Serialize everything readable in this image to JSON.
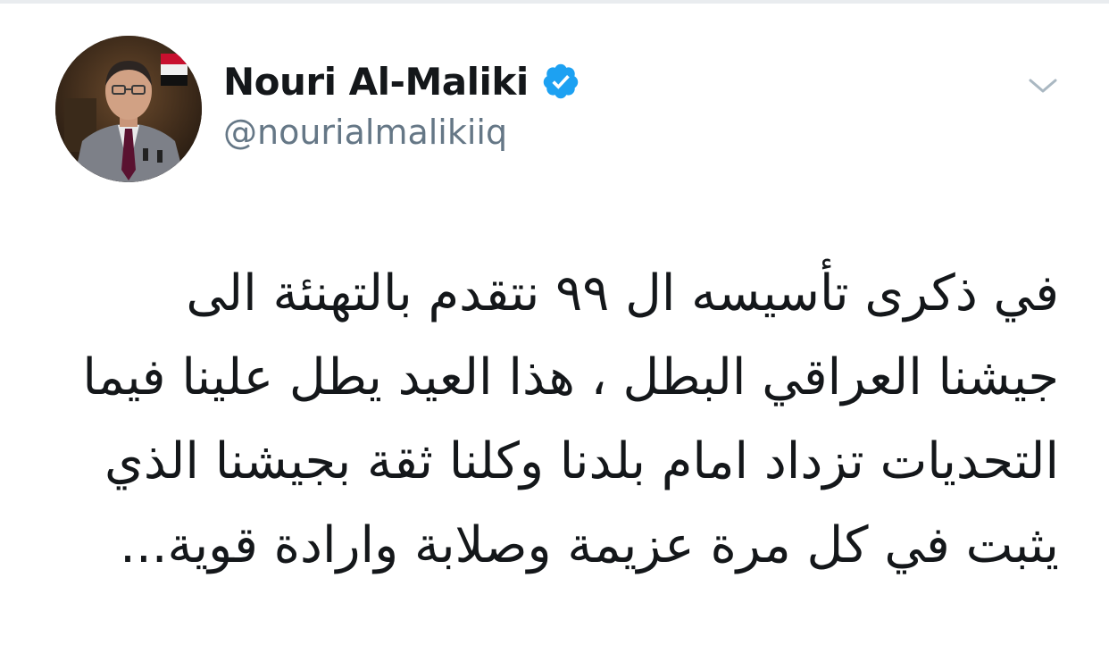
{
  "tweet": {
    "author": {
      "display_name": "Nouri Al-Maliki",
      "handle": "@nourialmalikiiq",
      "verified": true,
      "avatar_icon": "profile-photo"
    },
    "menu_icon": "chevron-down-icon",
    "text_lines": [
      "في ذكرى تأسيسه ال ٩٩ نتقدم بالتهنئة الى",
      "جيشنا العراقي البطل ، هذا العيد يطل علينا فيما",
      "التحديات تزداد امام بلدنا وكلنا ثقة بجيشنا الذي",
      "يثبت في كل مرة عزيمة وصلابة وارادة قوية..."
    ]
  },
  "colors": {
    "text": "#14171a",
    "secondary": "#657786",
    "verified": "#1da1f2",
    "caret": "#aab8c2"
  }
}
